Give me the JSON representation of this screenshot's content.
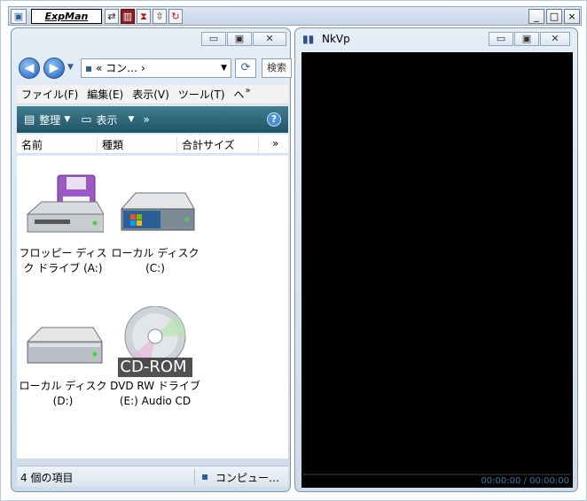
{
  "toolbar": {
    "app_label": "ExpMan",
    "minimize": "_",
    "maximize": "□",
    "close": "×"
  },
  "explorer": {
    "address_text": "«  コン…  ›",
    "search_label": "検索",
    "menus": [
      "ファイル(F)",
      "編集(E)",
      "表示(V)",
      "ツール(T)",
      "ヘ"
    ],
    "menu_overflow": "»",
    "commands": {
      "organize": "整理",
      "view": "表示",
      "more": "»"
    },
    "columns": [
      "名前",
      "種類",
      "合計サイズ"
    ],
    "columns_overflow": "»",
    "items": [
      {
        "label": "フロッピー ディスク ドライブ (A:)",
        "icon": "floppy-drive-icon"
      },
      {
        "label": "ローカル ディスク (C:)",
        "icon": "local-disk-c-icon"
      },
      {
        "label": "ローカル ディスク (D:)",
        "icon": "local-disk-d-icon"
      },
      {
        "label": "DVD RW ドライブ (E:) Audio CD",
        "icon": "cd-rom-icon",
        "badge": "CD-ROM"
      }
    ],
    "status_count": "4 個の項目",
    "status_location": "コンピュー…"
  },
  "player": {
    "title": "NkVp",
    "time": "00:00:00 / 00:00:00"
  },
  "colors": {
    "command_bar": "#2b6677",
    "player_bg": "#000000",
    "time_text": "#2f7da8"
  }
}
